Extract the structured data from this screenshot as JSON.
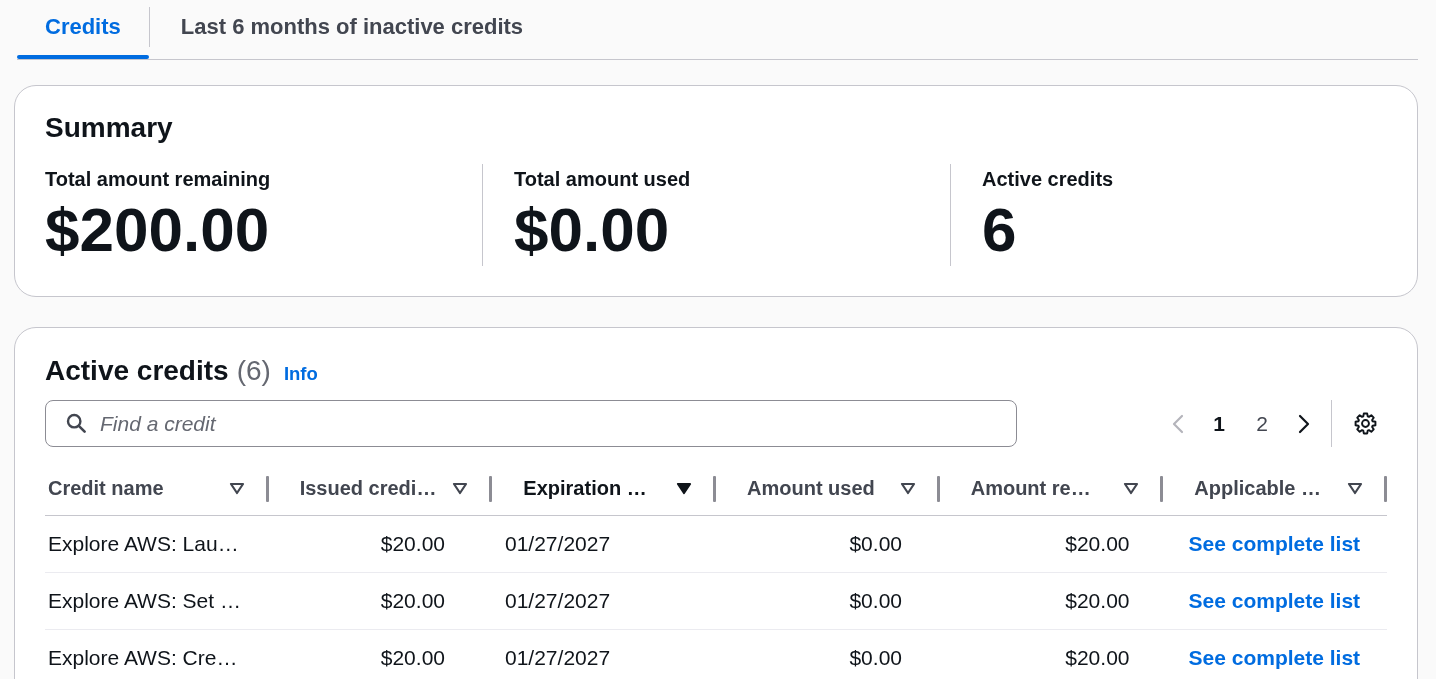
{
  "tabs": [
    {
      "label": "Credits",
      "selected": true
    },
    {
      "label": "Last 6 months of inactive credits",
      "selected": false
    }
  ],
  "summary": {
    "title": "Summary",
    "metrics": [
      {
        "label": "Total amount remaining",
        "value": "$200.00"
      },
      {
        "label": "Total amount used",
        "value": "$0.00"
      },
      {
        "label": "Active credits",
        "value": "6"
      }
    ]
  },
  "active_credits": {
    "title": "Active credits",
    "count": "(6)",
    "info_link": "Info",
    "search": {
      "placeholder": "Find a credit"
    },
    "pagination": {
      "previous": {
        "disabled": true
      },
      "pages": [
        {
          "label": "1",
          "selected": true
        },
        {
          "label": "2",
          "selected": false
        }
      ],
      "next": {
        "disabled": false
      }
    },
    "table": {
      "columns": [
        {
          "label": "Credit name",
          "kind": "text",
          "sorted": false
        },
        {
          "label": "Issued credi…",
          "kind": "amount",
          "sorted": false
        },
        {
          "label": "Expiration …",
          "kind": "date",
          "sorted": true
        },
        {
          "label": "Amount used",
          "kind": "amount",
          "sorted": false
        },
        {
          "label": "Amount re…",
          "kind": "amount",
          "sorted": false
        },
        {
          "label": "Applicable …",
          "kind": "link",
          "sorted": false
        }
      ],
      "rows": [
        [
          "Explore AWS: Lau…",
          "$20.00",
          "01/27/2027",
          "$0.00",
          "$20.00",
          "See complete list"
        ],
        [
          "Explore AWS: Set …",
          "$20.00",
          "01/27/2027",
          "$0.00",
          "$20.00",
          "See complete list"
        ],
        [
          "Explore AWS: Cre…",
          "$20.00",
          "01/27/2027",
          "$0.00",
          "$20.00",
          "See complete list"
        ]
      ]
    }
  }
}
